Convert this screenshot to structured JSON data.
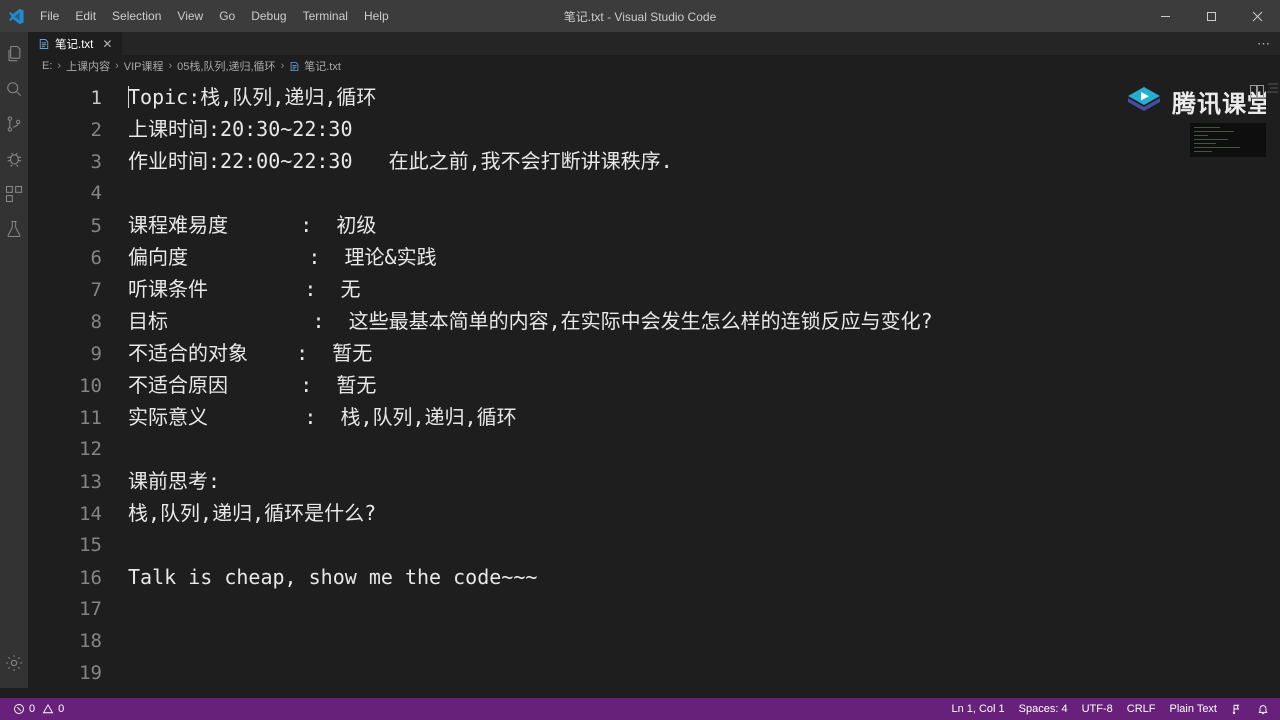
{
  "window": {
    "title": "笔记.txt - Visual Studio Code",
    "minimize_label": "Minimize",
    "restore_label": "Restore",
    "close_label": "Close"
  },
  "menu": {
    "items": [
      {
        "label": "File"
      },
      {
        "label": "Edit"
      },
      {
        "label": "Selection"
      },
      {
        "label": "View"
      },
      {
        "label": "Go"
      },
      {
        "label": "Debug"
      },
      {
        "label": "Terminal"
      },
      {
        "label": "Help"
      }
    ]
  },
  "activity_bar": {
    "items": [
      {
        "name": "explorer",
        "title": "Explorer"
      },
      {
        "name": "search",
        "title": "Search"
      },
      {
        "name": "source-control",
        "title": "Source Control"
      },
      {
        "name": "debug",
        "title": "Debug"
      },
      {
        "name": "extensions",
        "title": "Extensions"
      },
      {
        "name": "testing",
        "title": "Testing"
      }
    ],
    "bottom": [
      {
        "name": "manage",
        "title": "Manage"
      }
    ]
  },
  "tabs": [
    {
      "label": "笔记.txt",
      "close": "✕",
      "active": true
    }
  ],
  "tab_actions": {
    "more": "⋯"
  },
  "breadcrumb": {
    "separator": "›",
    "items": [
      {
        "label": "E:"
      },
      {
        "label": "上课内容"
      },
      {
        "label": "VIP课程"
      },
      {
        "label": "05栈,队列,递归,循环"
      },
      {
        "label": "笔记.txt",
        "is_file": true
      }
    ]
  },
  "watermark": {
    "text": "腾讯课堂",
    "dots": "⋯"
  },
  "editor": {
    "lines": [
      {
        "n": "1",
        "text": "Topic:栈,队列,递归,循环",
        "caret": true
      },
      {
        "n": "2",
        "text": "上课时间:20:30~22:30"
      },
      {
        "n": "3",
        "text": "作业时间:22:00~22:30   在此之前,我不会打断讲课秩序."
      },
      {
        "n": "4",
        "text": ""
      },
      {
        "n": "5",
        "text": "课程难易度      :  初级"
      },
      {
        "n": "6",
        "text": "偏向度          :  理论&实践"
      },
      {
        "n": "7",
        "text": "听课条件        :  无"
      },
      {
        "n": "8",
        "text": "目标            :  这些最基本简单的内容,在实际中会发生怎么样的连锁反应与变化?"
      },
      {
        "n": "9",
        "text": "不适合的对象    :  暂无"
      },
      {
        "n": "10",
        "text": "不适合原因      :  暂无"
      },
      {
        "n": "11",
        "text": "实际意义        :  栈,队列,递归,循环"
      },
      {
        "n": "12",
        "text": ""
      },
      {
        "n": "13",
        "text": "课前思考:"
      },
      {
        "n": "14",
        "text": "栈,队列,递归,循环是什么?"
      },
      {
        "n": "15",
        "text": ""
      },
      {
        "n": "16",
        "text": "Talk is cheap, show me the code~~~"
      },
      {
        "n": "17",
        "text": ""
      },
      {
        "n": "18",
        "text": ""
      },
      {
        "n": "19",
        "text": ""
      }
    ]
  },
  "status_bar": {
    "errors": "0",
    "warnings": "0",
    "cursor_position": "Ln 1, Col 1",
    "indentation": "Spaces: 4",
    "encoding": "UTF-8",
    "eol": "CRLF",
    "language": "Plain Text"
  },
  "colors": {
    "titlebar_bg": "#3c3c3c",
    "activitybar_bg": "#333333",
    "editor_bg": "#1e1e1e",
    "tabbar_bg": "#252526",
    "statusbar_bg": "#68217a",
    "text": "#cccccc",
    "linenumber": "#858585",
    "accent_blue": "#6a9fd4"
  }
}
